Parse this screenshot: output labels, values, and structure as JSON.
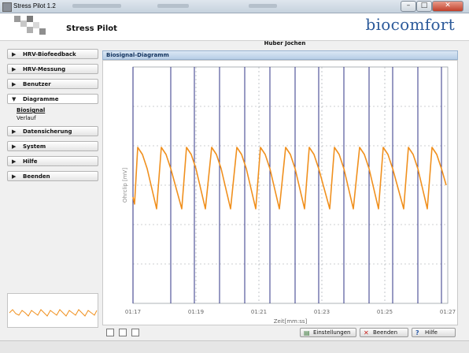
{
  "window": {
    "title": "Stress Pilot 1.2"
  },
  "header": {
    "app_name": "Stress Pilot",
    "brand": "biocomfort"
  },
  "user": {
    "name": "Huber Jochen"
  },
  "sidebar": {
    "items": [
      {
        "label": "HRV-Biofeedback",
        "icon": "triangle-right-icon"
      },
      {
        "label": "HRV-Messung",
        "icon": "triangle-right-icon"
      },
      {
        "label": "Benutzer",
        "icon": "triangle-right-icon"
      },
      {
        "label": "Diagramme",
        "icon": "triangle-down-icon",
        "expanded": true,
        "subitems": [
          {
            "label": "Biosignal",
            "selected": true
          },
          {
            "label": "Verlauf",
            "selected": false
          }
        ]
      },
      {
        "label": "Datensicherung",
        "icon": "triangle-right-icon"
      },
      {
        "label": "System",
        "icon": "triangle-right-icon"
      },
      {
        "label": "Hilfe",
        "icon": "triangle-right-icon"
      },
      {
        "label": "Beenden",
        "icon": "triangle-right-icon"
      }
    ]
  },
  "panel": {
    "title": "Biosignal-Diagramm"
  },
  "buttons": {
    "settings": "Einstellungen",
    "quit": "Beenden",
    "help": "Hilfe"
  },
  "colors": {
    "signal": "#f0901e",
    "beat_marker": "#1a1f7a",
    "panel_header": "#b7cde6",
    "brand": "#2c5a9a"
  },
  "chart_data": {
    "type": "line",
    "xlabel": "Zeit[mm:ss]",
    "ylabel": "Ohrclip [mV]",
    "x_ticks": [
      "01:17",
      "01:19",
      "01:21",
      "01:23",
      "01:25",
      "01:27"
    ],
    "xlim": [
      "01:17",
      "01:27"
    ],
    "grid": true,
    "series": [
      {
        "kind": "pulse-wave",
        "color": "#f0901e",
        "peaks_s": [
          0.3,
          1.8,
          3.4,
          5.0,
          6.6,
          8.1,
          9.7,
          11.2,
          12.8,
          14.4,
          15.9,
          17.5,
          19.0
        ],
        "troughs_s": [
          1.5,
          3.1,
          4.6,
          6.2,
          7.8,
          9.3,
          10.9,
          12.5,
          14.0,
          15.6,
          17.2,
          18.7
        ],
        "peak_level": 0.66,
        "trough_level": 0.4
      }
    ],
    "beat_markers_s": [
      0,
      2.4,
      3.9,
      5.5,
      7.1,
      8.7,
      10.3,
      11.8,
      13.4,
      15.0,
      16.5,
      18.1,
      19.6
    ]
  }
}
